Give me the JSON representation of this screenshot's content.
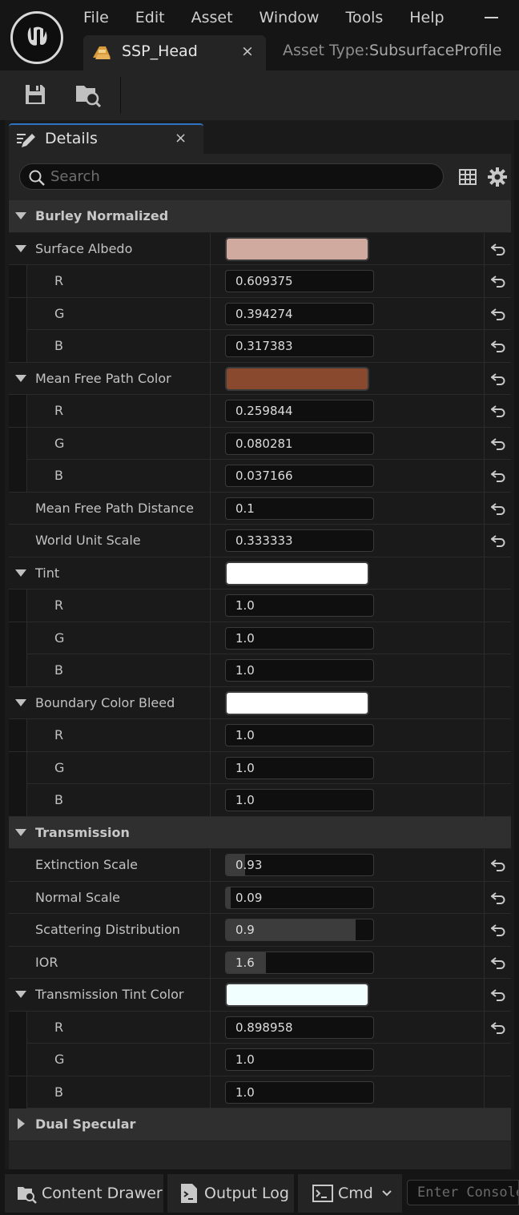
{
  "menu": [
    "File",
    "Edit",
    "Asset",
    "Window",
    "Tools",
    "Help"
  ],
  "asset_tab": {
    "label": "SSP_Head",
    "close": "×"
  },
  "asset_type": {
    "label": "Asset Type:",
    "value": "SubsurfaceProfile"
  },
  "toolbar": {
    "save": "save-icon",
    "browse": "browse-to-asset-icon"
  },
  "details_tab": {
    "label": "Details",
    "close": "×"
  },
  "search": {
    "placeholder": "Search"
  },
  "colors": {
    "surface_albedo": "#d1aa9f",
    "mean_free_path_color": "#89492e",
    "tint": "#ffffff",
    "boundary_color_bleed": "#ffffff",
    "transmission_tint_color": "#f2ffff",
    "accent": "#2f74c0"
  },
  "rows": [
    {
      "kind": "category",
      "label": "Burley Normalized",
      "expanded": true
    },
    {
      "kind": "color",
      "label": "Surface Albedo",
      "expanded": true,
      "color": "#d1aa9f",
      "reset": true
    },
    {
      "kind": "channel",
      "label": "R",
      "value": "0.609375",
      "reset": true
    },
    {
      "kind": "channel",
      "label": "G",
      "value": "0.394274",
      "reset": true
    },
    {
      "kind": "channel",
      "label": "B",
      "value": "0.317383",
      "reset": true
    },
    {
      "kind": "color",
      "label": "Mean Free Path Color",
      "expanded": true,
      "color": "#89492e",
      "reset": true
    },
    {
      "kind": "channel",
      "label": "R",
      "value": "0.259844",
      "reset": true
    },
    {
      "kind": "channel",
      "label": "G",
      "value": "0.080281",
      "reset": true
    },
    {
      "kind": "channel",
      "label": "B",
      "value": "0.037166",
      "reset": true
    },
    {
      "kind": "number",
      "label": "Mean Free Path Distance",
      "value": "0.1",
      "reset": true
    },
    {
      "kind": "number",
      "label": "World Unit Scale",
      "value": "0.333333",
      "reset": true
    },
    {
      "kind": "color",
      "label": "Tint",
      "expanded": true,
      "color": "#ffffff",
      "reset": false
    },
    {
      "kind": "channel",
      "label": "R",
      "value": "1.0",
      "reset": false
    },
    {
      "kind": "channel",
      "label": "G",
      "value": "1.0",
      "reset": false
    },
    {
      "kind": "channel",
      "label": "B",
      "value": "1.0",
      "reset": false
    },
    {
      "kind": "color",
      "label": "Boundary Color Bleed",
      "expanded": true,
      "color": "#ffffff",
      "reset": false
    },
    {
      "kind": "channel",
      "label": "R",
      "value": "1.0",
      "reset": false
    },
    {
      "kind": "channel",
      "label": "G",
      "value": "1.0",
      "reset": false
    },
    {
      "kind": "channel",
      "label": "B",
      "value": "1.0",
      "reset": false
    },
    {
      "kind": "category",
      "label": "Transmission",
      "expanded": true
    },
    {
      "kind": "slider",
      "label": "Extinction Scale",
      "value": "0.93",
      "fill": 0.13,
      "reset": true
    },
    {
      "kind": "slider",
      "label": "Normal Scale",
      "value": "0.09",
      "fill": 0.03,
      "reset": true
    },
    {
      "kind": "slider",
      "label": "Scattering Distribution",
      "value": "0.9",
      "fill": 0.88,
      "reset": true
    },
    {
      "kind": "slider",
      "label": "IOR",
      "value": "1.6",
      "fill": 0.27,
      "reset": true
    },
    {
      "kind": "color",
      "label": "Transmission Tint Color",
      "expanded": true,
      "color": "#f2ffff",
      "reset": true
    },
    {
      "kind": "channel",
      "label": "R",
      "value": "0.898958",
      "reset": true
    },
    {
      "kind": "channel",
      "label": "G",
      "value": "1.0",
      "reset": false
    },
    {
      "kind": "channel",
      "label": "B",
      "value": "1.0",
      "reset": false
    },
    {
      "kind": "category",
      "label": "Dual Specular",
      "expanded": false
    }
  ],
  "statusbar": {
    "content_drawer": "Content Drawer",
    "output_log": "Output Log",
    "cmd": "Cmd",
    "console_placeholder": "Enter Console Command"
  }
}
